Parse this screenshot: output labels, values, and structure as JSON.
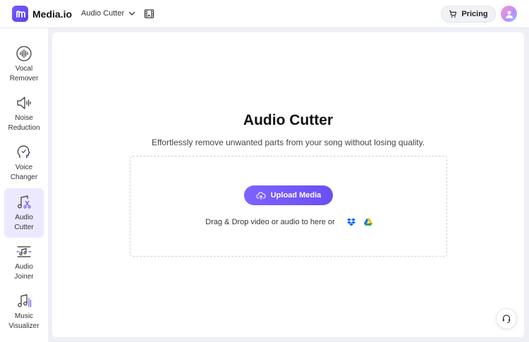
{
  "header": {
    "brand": "Media.io",
    "tool_selector": "Audio Cutter",
    "pricing_label": "Pricing"
  },
  "sidebar": {
    "items": [
      {
        "label": "Vocal Remover",
        "icon": "vocal-waveform-icon",
        "active": false
      },
      {
        "label": "Noise Reduction",
        "icon": "speaker-noise-icon",
        "active": false
      },
      {
        "label": "Voice Changer",
        "icon": "voice-head-icon",
        "active": false
      },
      {
        "label": "Audio Cutter",
        "icon": "music-scissors-icon",
        "active": true
      },
      {
        "label": "Audio Joiner",
        "icon": "music-join-icon",
        "active": false
      },
      {
        "label": "Music Visualizer",
        "icon": "music-bars-icon",
        "active": false
      }
    ]
  },
  "main": {
    "title": "Audio Cutter",
    "subtitle": "Effortlessly remove unwanted parts from your song without losing quality.",
    "upload_label": "Upload Media",
    "drag_text": "Drag & Drop video or audio to here or"
  },
  "colors": {
    "accent": "#7056f5",
    "active_bg": "#ece8ff",
    "page_bg": "#eef0f6"
  }
}
